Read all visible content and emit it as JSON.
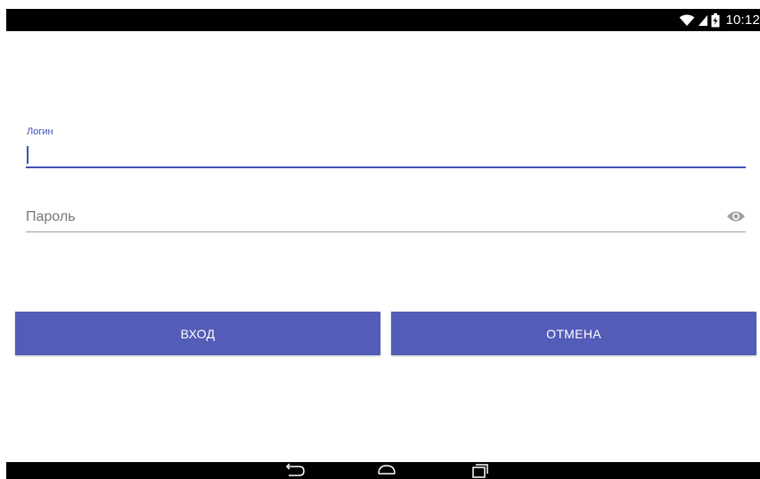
{
  "status_bar": {
    "time": "10:12",
    "icons": [
      "wifi-icon",
      "cell-signal-icon",
      "battery-charging-icon"
    ]
  },
  "login_form": {
    "login_label": "Логин",
    "login_value": "",
    "password_placeholder": "Пароль",
    "password_value": "",
    "password_toggle_icon": "eye-icon"
  },
  "actions": {
    "login_button": "ВХОД",
    "cancel_button": "ОТМЕНА"
  },
  "nav_bar": {
    "icons": [
      "back-icon",
      "home-icon",
      "recents-icon"
    ]
  },
  "colors": {
    "accent": "#3f51b5",
    "button": "#535cb6",
    "status_bar": "#000000",
    "background": "#ffffff"
  }
}
